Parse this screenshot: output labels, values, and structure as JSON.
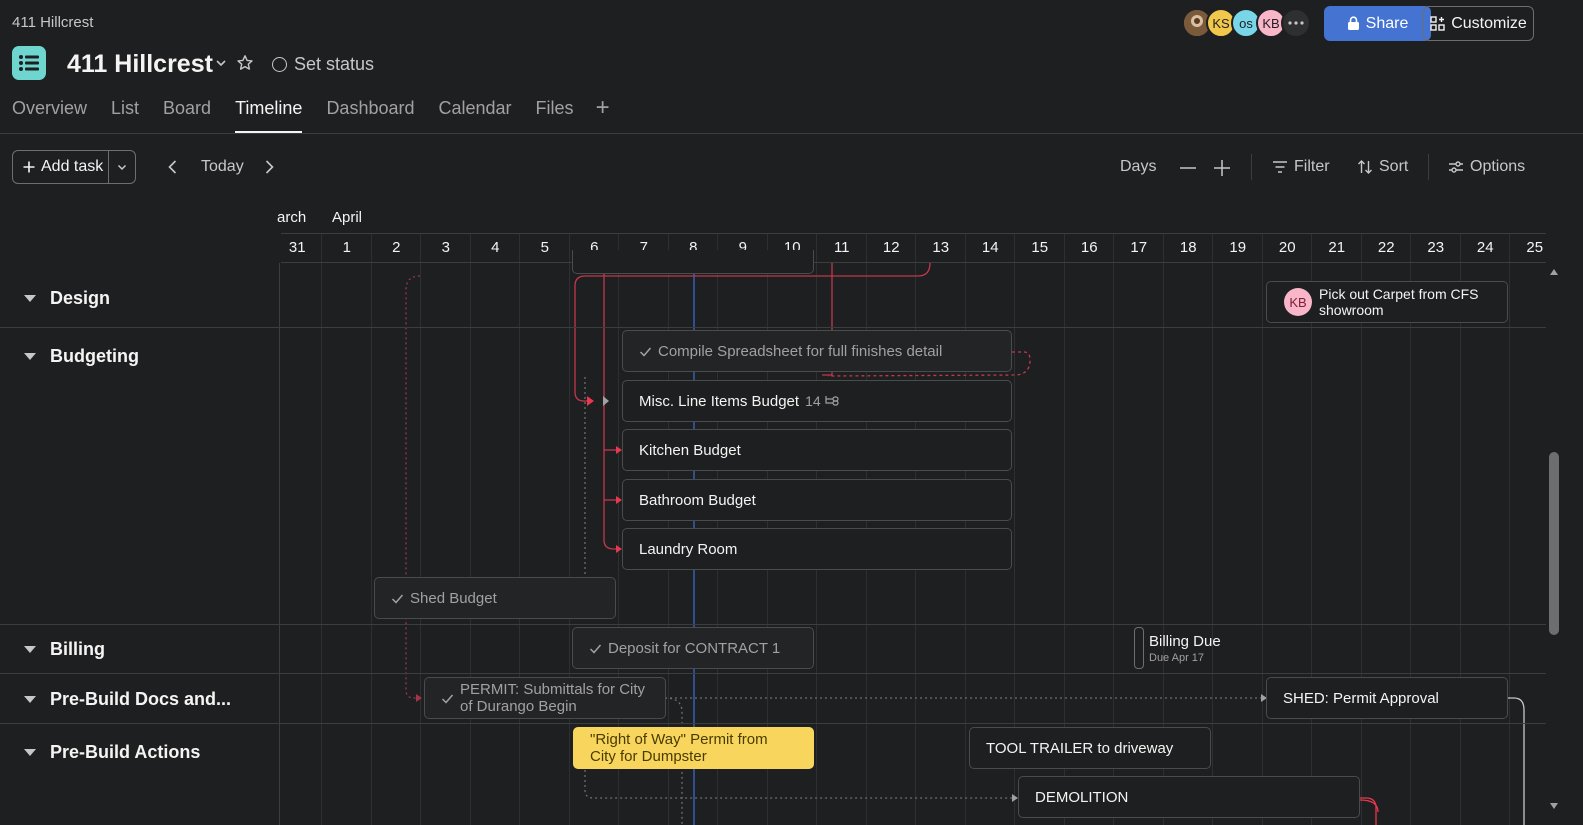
{
  "header": {
    "breadcrumb": "411 Hillcrest",
    "title": "411 Hillcrest",
    "set_status": "Set status",
    "share_label": "Share",
    "customize_label": "Customize",
    "avatars": [
      {
        "initials": "",
        "kind": "photo",
        "color": "#8a6a4a"
      },
      {
        "initials": "KS",
        "color": "#f1c84b"
      },
      {
        "initials": "os",
        "color": "#78d6e8"
      },
      {
        "initials": "KB",
        "color": "#f9b6c8"
      }
    ]
  },
  "tabs": [
    {
      "label": "Overview"
    },
    {
      "label": "List"
    },
    {
      "label": "Board"
    },
    {
      "label": "Timeline",
      "active": true
    },
    {
      "label": "Dashboard"
    },
    {
      "label": "Calendar"
    },
    {
      "label": "Files"
    }
  ],
  "toolbar": {
    "add_task": "Add task",
    "today": "Today",
    "zoom": "Days",
    "filter": "Filter",
    "sort": "Sort",
    "options": "Options"
  },
  "timeline": {
    "months": [
      "arch",
      "April"
    ],
    "days": [
      "31",
      "1",
      "2",
      "3",
      "4",
      "5",
      "6",
      "7",
      "8",
      "9",
      "10",
      "11",
      "12",
      "13",
      "14",
      "15",
      "16",
      "17",
      "18",
      "19",
      "20",
      "21",
      "22",
      "23",
      "24",
      "25"
    ],
    "today_day": "8"
  },
  "sections": [
    {
      "label": "Design"
    },
    {
      "label": "Budgeting"
    },
    {
      "label": "Billing"
    },
    {
      "label": "Pre-Build Docs and..."
    },
    {
      "label": "Pre-Build Actions"
    }
  ],
  "tasks": {
    "pick_carpet": {
      "assignee": "KB",
      "line1": "Pick out Carpet from CFS",
      "line2": "showroom"
    },
    "compile": "Compile Spreadsheet for full finishes detail",
    "misc": "Misc. Line Items Budget",
    "misc_subtasks": "14",
    "kitchen": "Kitchen Budget",
    "bathroom": "Bathroom Budget",
    "laundry": "Laundry Room",
    "shed_budget": "Shed Budget",
    "deposit": "Deposit for CONTRACT 1",
    "billing_due": "Billing Due",
    "billing_due_sub": "Due Apr 17",
    "permit": {
      "line1": "PERMIT: Submittals for City",
      "line2": "of Durango Begin"
    },
    "shed_permit": "SHED: Permit Approval",
    "row_permit": {
      "line1": "\"Right of Way\" Permit from",
      "line2": "City for Dumpster"
    },
    "tool_trailer": "TOOL TRAILER to driveway",
    "demolition": "DEMOLITION"
  },
  "colors": {
    "background": "#1e1f21",
    "accent": "#4573d2",
    "dependency": "#e8384f",
    "highlight": "#f8d65e",
    "brand_icon": "#6fd6cf"
  }
}
